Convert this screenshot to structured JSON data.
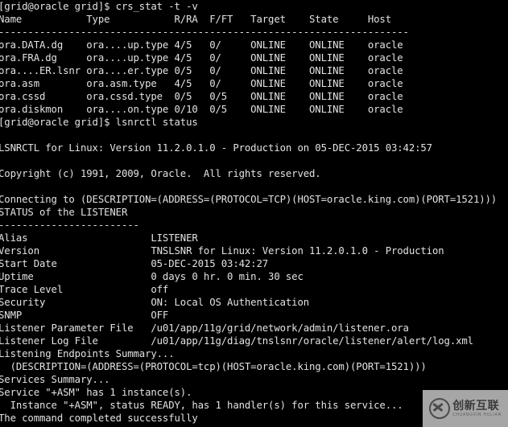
{
  "terminal": {
    "background_color": "#000000",
    "foreground_color": "#e2e2e2",
    "prompt": "[grid@oracle grid]$",
    "lines": [
      "[grid@oracle grid]$ crs_stat -t -v",
      "Name           Type           R/RA  F/FT   Target    State     Host",
      "----------------------------------------------------------------------",
      "ora.DATA.dg    ora....up.type 4/5   0/     ONLINE    ONLINE    oracle",
      "ora.FRA.dg     ora....up.type 4/5   0/     ONLINE    ONLINE    oracle",
      "ora....ER.lsnr ora....er.type 0/5   0/     ONLINE    ONLINE    oracle",
      "ora.asm        ora.asm.type   4/5   0/     ONLINE    ONLINE    oracle",
      "ora.cssd       ora.cssd.type  0/5   0/5    ONLINE    ONLINE    oracle",
      "ora.diskmon    ora....on.type 0/10  0/5    ONLINE    ONLINE    oracle",
      "[grid@oracle grid]$ lsnrctl status",
      "",
      "LSNRCTL for Linux: Version 11.2.0.1.0 - Production on 05-DEC-2015 03:42:57",
      "",
      "Copyright (c) 1991, 2009, Oracle.  All rights reserved.",
      "",
      "Connecting to (DESCRIPTION=(ADDRESS=(PROTOCOL=TCP)(HOST=oracle.king.com)(PORT=1521)))",
      "STATUS of the LISTENER",
      "------------------------",
      "Alias                     LISTENER",
      "Version                   TNSLSNR for Linux: Version 11.2.0.1.0 - Production",
      "Start Date                05-DEC-2015 03:42:27",
      "Uptime                    0 days 0 hr. 0 min. 30 sec",
      "Trace Level               off",
      "Security                  ON: Local OS Authentication",
      "SNMP                      OFF",
      "Listener Parameter File   /u01/app/11g/grid/network/admin/listener.ora",
      "Listener Log File         /u01/app/11g/diag/tnslsnr/oracle/listener/alert/log.xml",
      "Listening Endpoints Summary...",
      "  (DESCRIPTION=(ADDRESS=(PROTOCOL=tcp)(HOST=oracle.king.com)(PORT=1521)))",
      "Services Summary...",
      "Service \"+ASM\" has 1 instance(s).",
      "  Instance \"+ASM\", status READY, has 1 handler(s) for this service...",
      "The command completed successfully"
    ]
  },
  "crs_stat": {
    "command": "crs_stat -t -v",
    "columns": [
      "Name",
      "Type",
      "R/RA",
      "F/FT",
      "Target",
      "State",
      "Host"
    ],
    "rows": [
      [
        "ora.DATA.dg",
        "ora....up.type",
        "4/5",
        "0/",
        "ONLINE",
        "ONLINE",
        "oracle"
      ],
      [
        "ora.FRA.dg",
        "ora....up.type",
        "4/5",
        "0/",
        "ONLINE",
        "ONLINE",
        "oracle"
      ],
      [
        "ora....ER.lsnr",
        "ora....er.type",
        "0/5",
        "0/",
        "ONLINE",
        "ONLINE",
        "oracle"
      ],
      [
        "ora.asm",
        "ora.asm.type",
        "4/5",
        "0/",
        "ONLINE",
        "ONLINE",
        "oracle"
      ],
      [
        "ora.cssd",
        "ora.cssd.type",
        "0/5",
        "0/5",
        "ONLINE",
        "ONLINE",
        "oracle"
      ],
      [
        "ora.diskmon",
        "ora....on.type",
        "0/10",
        "0/5",
        "ONLINE",
        "ONLINE",
        "oracle"
      ]
    ]
  },
  "lsnrctl": {
    "command": "lsnrctl status",
    "banner": "LSNRCTL for Linux: Version 11.2.0.1.0 - Production on 05-DEC-2015 03:42:57",
    "copyright": "Copyright (c) 1991, 2009, Oracle.  All rights reserved.",
    "connecting": "Connecting to (DESCRIPTION=(ADDRESS=(PROTOCOL=TCP)(HOST=oracle.king.com)(PORT=1521)))",
    "status_heading": "STATUS of the LISTENER",
    "status_rule": "------------------------",
    "fields": [
      {
        "label": "Alias",
        "value": "LISTENER"
      },
      {
        "label": "Version",
        "value": "TNSLSNR for Linux: Version 11.2.0.1.0 - Production"
      },
      {
        "label": "Start Date",
        "value": "05-DEC-2015 03:42:27"
      },
      {
        "label": "Uptime",
        "value": "0 days 0 hr. 0 min. 30 sec"
      },
      {
        "label": "Trace Level",
        "value": "off"
      },
      {
        "label": "Security",
        "value": "ON: Local OS Authentication"
      },
      {
        "label": "SNMP",
        "value": "OFF"
      },
      {
        "label": "Listener Parameter File",
        "value": "/u01/app/11g/grid/network/admin/listener.ora"
      },
      {
        "label": "Listener Log File",
        "value": "/u01/app/11g/diag/tnslsnr/oracle/listener/alert/log.xml"
      }
    ],
    "endpoints_heading": "Listening Endpoints Summary...",
    "endpoint": "  (DESCRIPTION=(ADDRESS=(PROTOCOL=tcp)(HOST=oracle.king.com)(PORT=1521)))",
    "services_heading": "Services Summary...",
    "service": "Service \"+ASM\" has 1 instance(s).",
    "instance": "  Instance \"+ASM\", status READY, has 1 handler(s) for this service...",
    "result": "The command completed successfully"
  },
  "watermark": {
    "logo_name": "circled-x-icon",
    "chinese_text": "创新互联",
    "pinyin_text": "CHUANGXIN HULIAN"
  }
}
